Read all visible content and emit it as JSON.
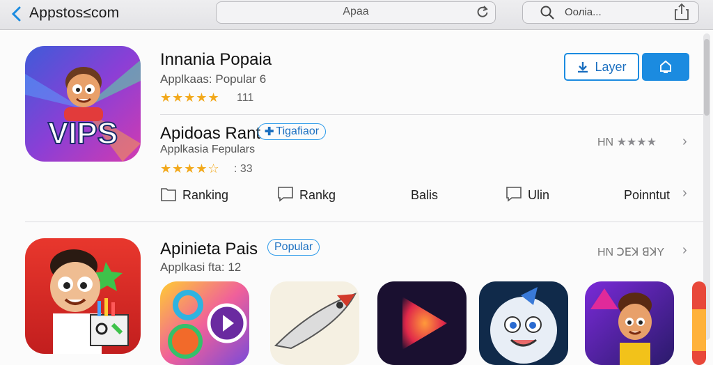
{
  "browser": {
    "site": "Appstos≤com",
    "url": "Apaa",
    "search": "Ооліа..."
  },
  "featured": {
    "icon_label": "VIPS",
    "title": "Innania Popaia",
    "subtitle": "Applkaas: Popular 6",
    "stars": "★★★★★",
    "rating_count": "111",
    "layer_button": "Layer",
    "actions": {
      "download_icon": "download-icon",
      "share_icon": "share-icon"
    }
  },
  "apps": [
    {
      "title": "Apidoas Rant",
      "badge": "Tigafiaor",
      "subtitle": "Applkasia Fepulars",
      "stars": "★★★★☆",
      "rating_count": ": 33",
      "meta_prefix": "HN",
      "meta_stars": "★★★★"
    },
    {
      "title": "Apinieta Pais",
      "badge": "Popular",
      "subtitle": "Applkasi fta: 12",
      "meta": "HN ꓛꓰꓘ ꓭꓘY"
    }
  ],
  "ranking_tabs": [
    {
      "label": "Ranking",
      "icon": "square-icon"
    },
    {
      "label": "Rankg",
      "icon": "chat-icon"
    },
    {
      "label": "Balis",
      "icon": ""
    },
    {
      "label": "Ulin",
      "icon": "chat-icon"
    },
    {
      "label": "Poinntut",
      "icon": ""
    }
  ],
  "colors": {
    "accent": "#1b8be0",
    "star": "#f2a81a"
  }
}
